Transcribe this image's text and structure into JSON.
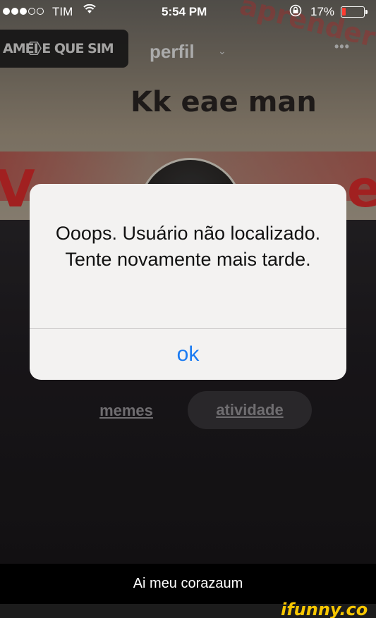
{
  "status_bar": {
    "carrier": "TIM",
    "time": "5:54 PM",
    "battery_percent": "17%",
    "battery_level": 0.17,
    "battery_color": "#ff3b30",
    "signal_strength": 3,
    "signal_max": 5,
    "icons": [
      "wifi-icon",
      "rotation-lock-icon",
      "battery-icon"
    ]
  },
  "header": {
    "logo_text": "AMEI E QUE SIM",
    "title": "perfil",
    "settings_icon": "gear-icon",
    "more_icon": "more-icon"
  },
  "background": {
    "caption_text": "Kk eae man",
    "watermark_text": "aprender"
  },
  "tabs": [
    {
      "label": "memes",
      "active": false
    },
    {
      "label": "atividade",
      "active": true
    }
  ],
  "alert": {
    "message": "Ooops. Usuário não localizado. Tente novamente mais tarde.",
    "button_label": "ok",
    "accent_color": "#1a7bf2"
  },
  "caption": "Ai meu corazaum",
  "brand": "ifunny.co"
}
